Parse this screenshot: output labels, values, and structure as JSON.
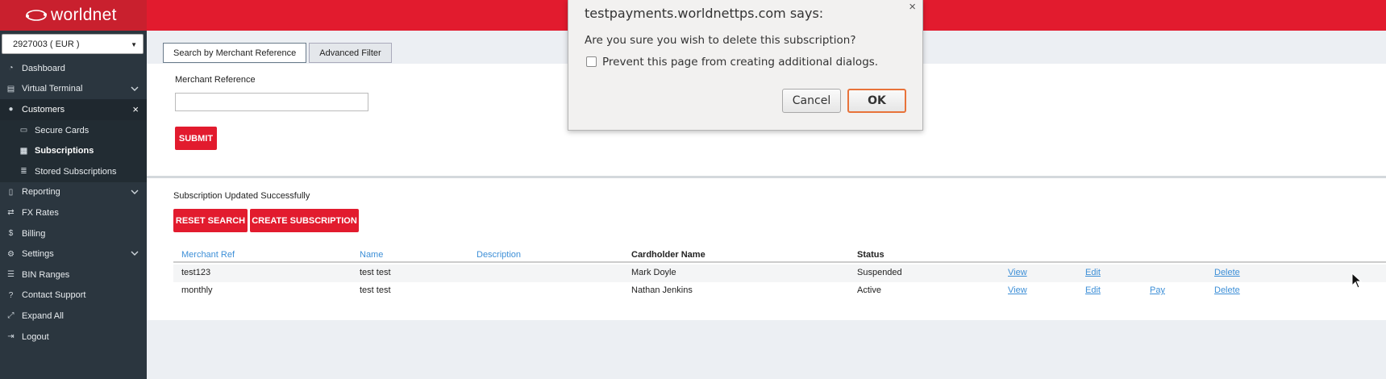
{
  "brand": {
    "name": "worldnet"
  },
  "account": {
    "selected": "2927003 ( EUR )"
  },
  "sidebar": {
    "items": [
      {
        "label": "Dashboard",
        "icon": "dashboard-icon"
      },
      {
        "label": "Virtual Terminal",
        "icon": "terminal-icon"
      },
      {
        "label": "Customers",
        "icon": "users-icon"
      },
      {
        "label": "Reporting",
        "icon": "report-icon"
      },
      {
        "label": "FX Rates",
        "icon": "exchange-icon"
      },
      {
        "label": "Billing",
        "icon": "dollar-icon"
      },
      {
        "label": "Settings",
        "icon": "gear-icon"
      },
      {
        "label": "BIN Ranges",
        "icon": "list-icon"
      },
      {
        "label": "Contact Support",
        "icon": "help-icon"
      },
      {
        "label": "Expand All",
        "icon": "expand-icon"
      },
      {
        "label": "Logout",
        "icon": "logout-icon"
      }
    ],
    "customers_sub": [
      {
        "label": "Secure Cards",
        "icon": "card-icon"
      },
      {
        "label": "Subscriptions",
        "icon": "subscriptions-icon"
      },
      {
        "label": "Stored Subscriptions",
        "icon": "database-icon"
      }
    ]
  },
  "tabs": [
    {
      "label": "Search by Merchant Reference",
      "active": true
    },
    {
      "label": "Advanced Filter",
      "active": false
    }
  ],
  "search": {
    "label": "Merchant Reference",
    "value": "",
    "submit_label": "SUBMIT"
  },
  "results": {
    "message": "Subscription Updated Successfully",
    "reset_label": "RESET SEARCH",
    "create_label": "CREATE SUBSCRIPTION",
    "columns": [
      "Merchant Ref",
      "Name",
      "Description",
      "Cardholder Name",
      "Status"
    ],
    "rows": [
      {
        "merchant_ref": "test123",
        "name": "test test",
        "description": "",
        "cardholder": "Mark Doyle",
        "status": "Suspended",
        "view": "View",
        "edit": "Edit",
        "pay": "",
        "delete": "Delete"
      },
      {
        "merchant_ref": "monthly",
        "name": "test test",
        "description": "",
        "cardholder": "Nathan Jenkins",
        "status": "Active",
        "view": "View",
        "edit": "Edit",
        "pay": "Pay",
        "delete": "Delete"
      }
    ]
  },
  "dialog": {
    "title": "testpayments.worldnettps.com says:",
    "message": "Are you sure you wish to delete this subscription?",
    "checkbox_label": "Prevent this page from creating additional dialogs.",
    "checkbox_checked": false,
    "cancel_label": "Cancel",
    "ok_label": "OK",
    "close_glyph": "×"
  },
  "colors": {
    "brand_red": "#e21b2e",
    "sidebar_bg": "#2b363f",
    "link_blue": "#3d8fd7"
  }
}
